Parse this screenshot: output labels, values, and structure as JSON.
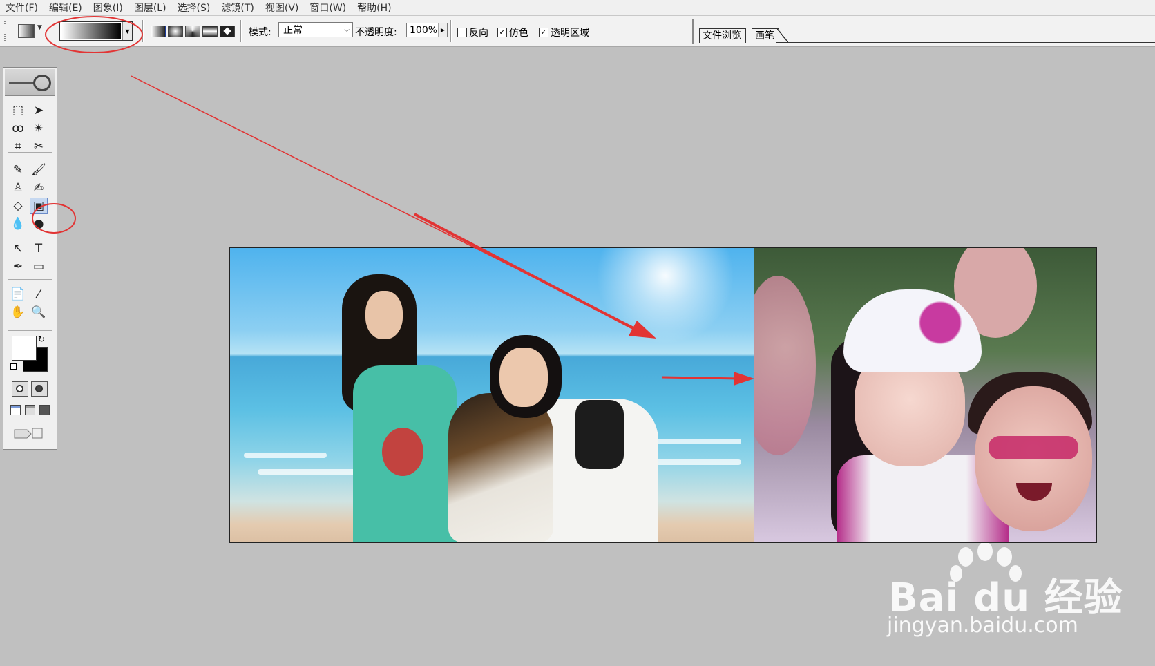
{
  "menu": {
    "items": [
      "文件(F)",
      "编辑(E)",
      "图象(I)",
      "图层(L)",
      "选择(S)",
      "滤镜(T)",
      "视图(V)",
      "窗口(W)",
      "帮助(H)"
    ]
  },
  "options": {
    "mode_label": "模式:",
    "mode_value": "正常",
    "opacity_label": "不透明度:",
    "opacity_value": "100%",
    "reverse_label": "反向",
    "dither_label": "仿色",
    "transparency_label": "透明区域",
    "reverse_checked": false,
    "dither_checked": true,
    "transparency_checked": true,
    "gradient_type_selected": "linear"
  },
  "palette_tabs": {
    "file_browser": "文件浏览",
    "brushes": "画笔"
  },
  "toolbox": {
    "selected_tool": "gradient-tool",
    "foreground_color": "#ffffff",
    "background_color": "#000000",
    "tools": [
      {
        "name": "marquee-tool",
        "glyph": "⬚"
      },
      {
        "name": "move-tool",
        "glyph": "➤"
      },
      {
        "name": "lasso-tool",
        "glyph": "ꝏ"
      },
      {
        "name": "magic-wand-tool",
        "glyph": "✴"
      },
      {
        "name": "crop-tool",
        "glyph": "⌗"
      },
      {
        "name": "slice-tool",
        "glyph": "✂"
      },
      {
        "name": "healing-brush-tool",
        "glyph": "✎"
      },
      {
        "name": "brush-tool",
        "glyph": "🖌"
      },
      {
        "name": "clone-stamp-tool",
        "glyph": "♙"
      },
      {
        "name": "history-brush-tool",
        "glyph": "✍"
      },
      {
        "name": "eraser-tool",
        "glyph": "◇"
      },
      {
        "name": "gradient-tool",
        "glyph": "▣"
      },
      {
        "name": "blur-tool",
        "glyph": "💧"
      },
      {
        "name": "burn-tool",
        "glyph": "●"
      },
      {
        "name": "path-selection-tool",
        "glyph": "↖"
      },
      {
        "name": "type-tool",
        "glyph": "T"
      },
      {
        "name": "pen-tool",
        "glyph": "✒"
      },
      {
        "name": "shape-tool",
        "glyph": "▭"
      },
      {
        "name": "notes-tool",
        "glyph": "📄"
      },
      {
        "name": "eyedropper-tool",
        "glyph": "⁄"
      },
      {
        "name": "hand-tool",
        "glyph": "✋"
      },
      {
        "name": "zoom-tool",
        "glyph": "🔍"
      }
    ]
  },
  "colors": {
    "annotation_red": "#e23434",
    "canvas_bg": "#c0c0c0"
  },
  "watermark": {
    "logo": "Bai du 经验",
    "url": "jingyan.baidu.com"
  }
}
